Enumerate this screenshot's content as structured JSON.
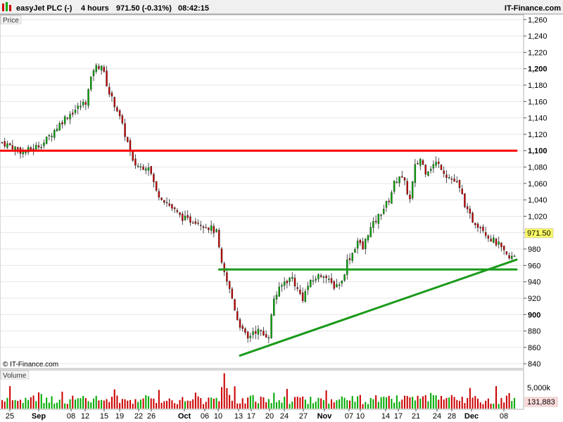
{
  "header": {
    "title": "easyJet PLC (-)",
    "interval": "4 hours",
    "last": "971.50 (-0.31%)",
    "time": "08:42:15",
    "brand": "IT-Finance.com"
  },
  "panels": {
    "price_label": "Price",
    "volume_label": "Volume",
    "watermark": "© IT-Finance.com",
    "last_price_tag": "971.50",
    "last_volume_tag": "131,883",
    "volume_tick": "5,000k"
  },
  "colors": {
    "up": "#00aa00",
    "down": "#cc0000",
    "resistance": "#ff0000",
    "support": "#1a9a1a",
    "grid": "#e6e6e6",
    "header_bg": "#f0f0f0"
  },
  "chart_data": {
    "type": "candlestick",
    "title": "easyJet PLC (-)",
    "interval": "4 hours",
    "ylim": [
      835,
      1265
    ],
    "yticks": [
      840,
      860,
      880,
      900,
      920,
      940,
      960,
      980,
      1000,
      1020,
      1040,
      1060,
      1080,
      1100,
      1120,
      1140,
      1160,
      1180,
      1200,
      1220,
      1240,
      1260
    ],
    "yticks_bold": [
      900,
      1000,
      1100,
      1200
    ],
    "xticks": [
      {
        "label": "25",
        "bold": false
      },
      {
        "label": "Sep",
        "bold": true
      },
      {
        "label": "08",
        "bold": false
      },
      {
        "label": "12",
        "bold": false
      },
      {
        "label": "15",
        "bold": false
      },
      {
        "label": "19",
        "bold": false
      },
      {
        "label": "22",
        "bold": false
      },
      {
        "label": "26",
        "bold": false
      },
      {
        "label": "Oct",
        "bold": true
      },
      {
        "label": "06",
        "bold": false
      },
      {
        "label": "10",
        "bold": false
      },
      {
        "label": "13",
        "bold": false
      },
      {
        "label": "17",
        "bold": false
      },
      {
        "label": "20",
        "bold": false
      },
      {
        "label": "24",
        "bold": false
      },
      {
        "label": "27",
        "bold": false
      },
      {
        "label": "Nov",
        "bold": true
      },
      {
        "label": "07",
        "bold": false
      },
      {
        "label": "10",
        "bold": false
      },
      {
        "label": "14",
        "bold": false
      },
      {
        "label": "17",
        "bold": false
      },
      {
        "label": "21",
        "bold": false
      },
      {
        "label": "24",
        "bold": false
      },
      {
        "label": "28",
        "bold": false
      },
      {
        "label": "Dec",
        "bold": true
      },
      {
        "label": "08",
        "bold": false
      }
    ],
    "last_price": 971.5,
    "close_path": [
      [
        0,
        1110
      ],
      [
        4,
        1105
      ],
      [
        8,
        1098
      ],
      [
        12,
        1103
      ],
      [
        16,
        1110
      ],
      [
        20,
        1125
      ],
      [
        24,
        1140
      ],
      [
        28,
        1150
      ],
      [
        32,
        1160
      ],
      [
        35,
        1200
      ],
      [
        38,
        1205
      ],
      [
        41,
        1170
      ],
      [
        44,
        1150
      ],
      [
        48,
        1110
      ],
      [
        50,
        1085
      ],
      [
        53,
        1080
      ],
      [
        56,
        1082
      ],
      [
        59,
        1050
      ],
      [
        62,
        1040
      ],
      [
        65,
        1030
      ],
      [
        68,
        1020
      ],
      [
        71,
        1015
      ],
      [
        74,
        1015
      ],
      [
        77,
        1010
      ],
      [
        80,
        1005
      ],
      [
        82,
        1000
      ],
      [
        84,
        960
      ],
      [
        86,
        940
      ],
      [
        88,
        920
      ],
      [
        90,
        895
      ],
      [
        92,
        880
      ],
      [
        94,
        870
      ],
      [
        96,
        880
      ],
      [
        98,
        880
      ],
      [
        100,
        875
      ],
      [
        102,
        875
      ],
      [
        104,
        920
      ],
      [
        106,
        930
      ],
      [
        108,
        940
      ],
      [
        111,
        945
      ],
      [
        113,
        930
      ],
      [
        115,
        920
      ],
      [
        117,
        935
      ],
      [
        120,
        945
      ],
      [
        123,
        950
      ],
      [
        125,
        940
      ],
      [
        127,
        935
      ],
      [
        130,
        940
      ],
      [
        132,
        965
      ],
      [
        134,
        975
      ],
      [
        136,
        990
      ],
      [
        138,
        980
      ],
      [
        140,
        1000
      ],
      [
        142,
        1010
      ],
      [
        144,
        1020
      ],
      [
        146,
        1030
      ],
      [
        148,
        1040
      ],
      [
        150,
        1060
      ],
      [
        152,
        1070
      ],
      [
        154,
        1060
      ],
      [
        156,
        1040
      ],
      [
        158,
        1080
      ],
      [
        160,
        1090
      ],
      [
        162,
        1075
      ],
      [
        164,
        1080
      ],
      [
        166,
        1085
      ],
      [
        168,
        1080
      ],
      [
        170,
        1070
      ],
      [
        172,
        1065
      ],
      [
        174,
        1060
      ],
      [
        176,
        1045
      ],
      [
        178,
        1025
      ],
      [
        180,
        1015
      ],
      [
        182,
        1010
      ],
      [
        184,
        1005
      ],
      [
        186,
        995
      ],
      [
        188,
        990
      ],
      [
        190,
        985
      ],
      [
        192,
        975
      ],
      [
        194,
        968
      ],
      [
        196,
        971.5
      ]
    ],
    "series": [
      {
        "name": "Price",
        "kind": "candles"
      },
      {
        "name": "Volume",
        "kind": "bars",
        "ylim": [
          0,
          7000000
        ],
        "ytick": 5000000
      }
    ],
    "lines": [
      {
        "name": "resistance",
        "points": [
          [
            0,
            1100
          ],
          [
            196,
            1100
          ]
        ]
      },
      {
        "name": "support-horizontal",
        "points": [
          [
            83,
            955
          ],
          [
            196,
            955
          ]
        ]
      },
      {
        "name": "uptrend",
        "points": [
          [
            91,
            850
          ],
          [
            196,
            967
          ]
        ]
      }
    ]
  }
}
